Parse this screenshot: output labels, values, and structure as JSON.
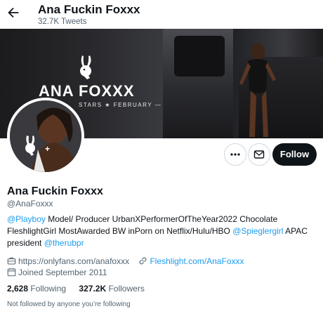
{
  "header": {
    "title": "Ana Fuckin Foxxx",
    "tweet_count": "32.7K Tweets"
  },
  "banner": {
    "brand": "ANA FOXXX",
    "tagline": "STARS ★ FEBRUARY —"
  },
  "actions": {
    "follow_label": "Follow"
  },
  "profile": {
    "name": "Ana Fuckin Foxxx",
    "handle": "@AnaFoxxx",
    "bio": {
      "mention1": "@Playboy",
      "text1": " Model/ Producer UrbanXPerformerOfTheYear2022 Chocolate FleshlightGirl MostAwarded BW inPorn on Netflix/Hulu/HBO ",
      "mention2": "@Spieglergirl",
      "text2": " APAC president ",
      "mention3": "@therubpr"
    },
    "professional_category": "https://onlyfans.com/anafoxxx",
    "website": "Fleshlight.com/AnaFoxxx",
    "joined": "Joined September 2011"
  },
  "stats": {
    "following_count": "2,628",
    "following_label": "Following",
    "followers_count": "327.2K",
    "followers_label": "Followers"
  },
  "footer": {
    "not_followed": "Not followed by anyone you’re following"
  },
  "icons": {
    "back": "back-arrow-icon",
    "more": "more-dots-icon",
    "message": "envelope-icon",
    "category": "briefcase-icon",
    "link": "link-icon",
    "calendar": "calendar-icon",
    "bunny": "bunny-logo-icon"
  },
  "colors": {
    "link": "#1d9bf0",
    "follow_bg": "#0f1419",
    "muted_text": "#536471"
  }
}
